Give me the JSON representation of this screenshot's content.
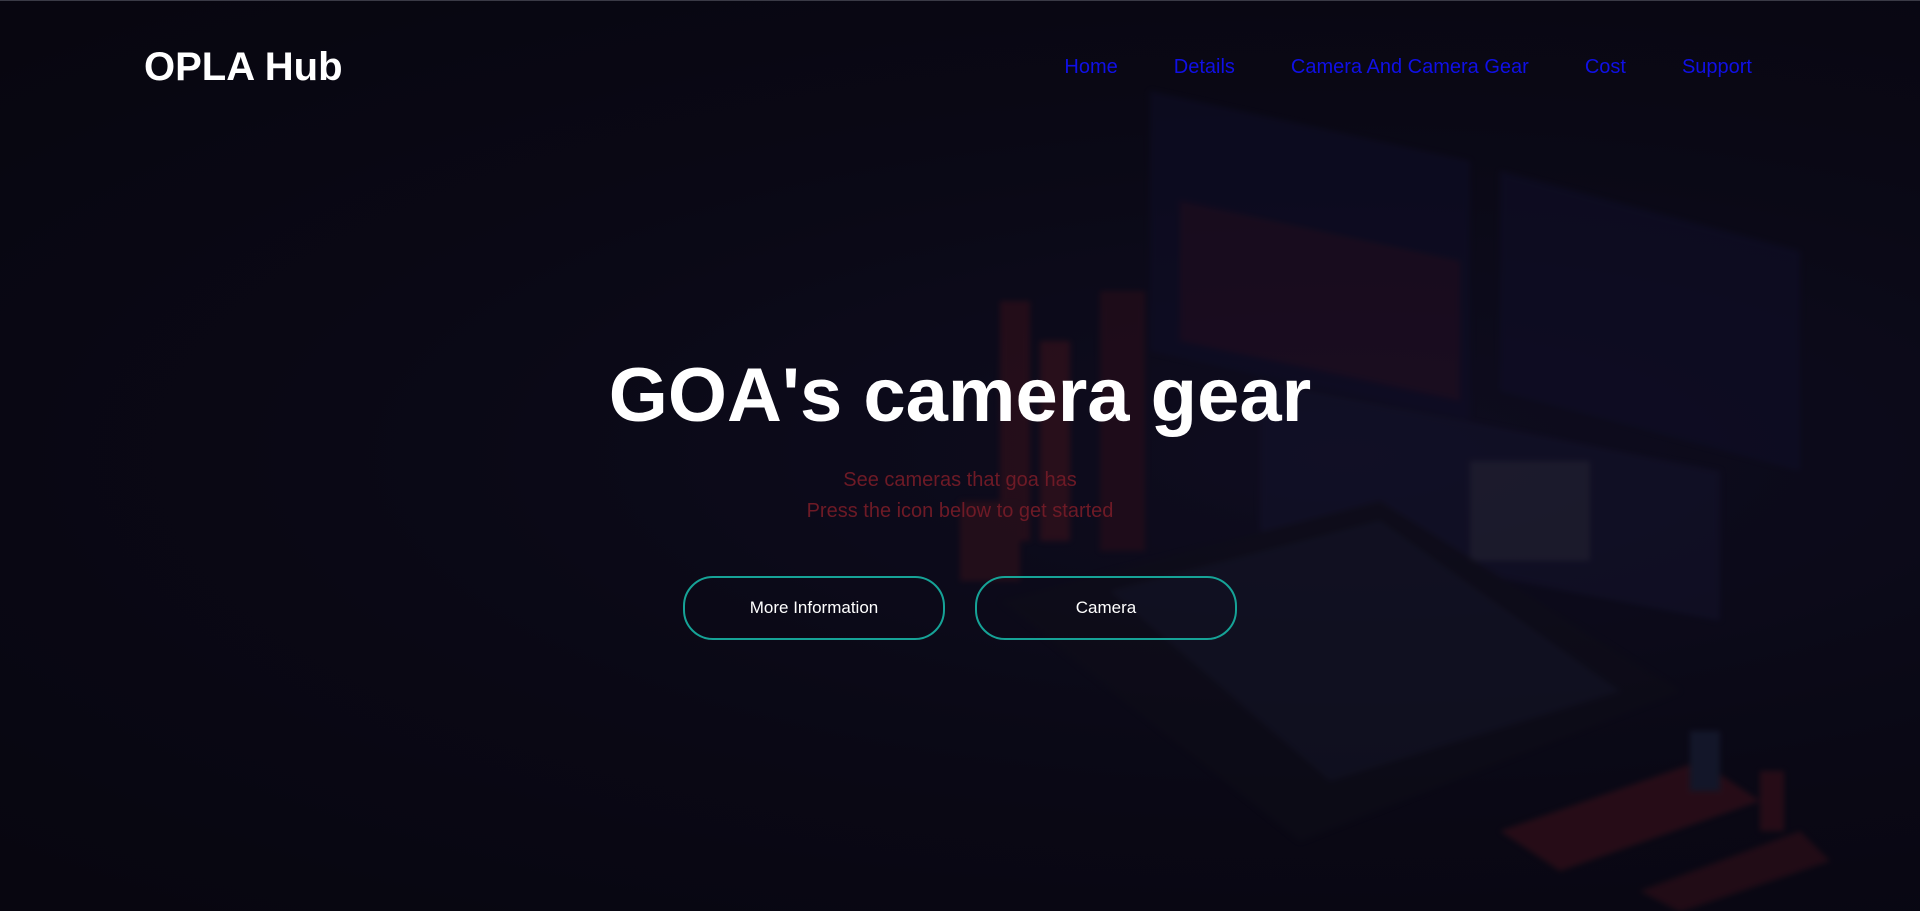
{
  "brand": {
    "title": "OPLA Hub"
  },
  "nav": {
    "items": [
      {
        "label": "Home"
      },
      {
        "label": "Details"
      },
      {
        "label": "Camera And Camera Gear"
      },
      {
        "label": "Cost"
      },
      {
        "label": "Support"
      }
    ]
  },
  "hero": {
    "title": "GOA's camera gear",
    "line1": "See cameras that goa has",
    "line2": "Press the icon below to get started"
  },
  "buttons": {
    "more_info": "More Information",
    "camera": "Camera"
  },
  "colors": {
    "background": "#0a0916",
    "nav_link": "#1010e6",
    "subtitle": "#6e1a26",
    "button_border": "#16a397"
  }
}
